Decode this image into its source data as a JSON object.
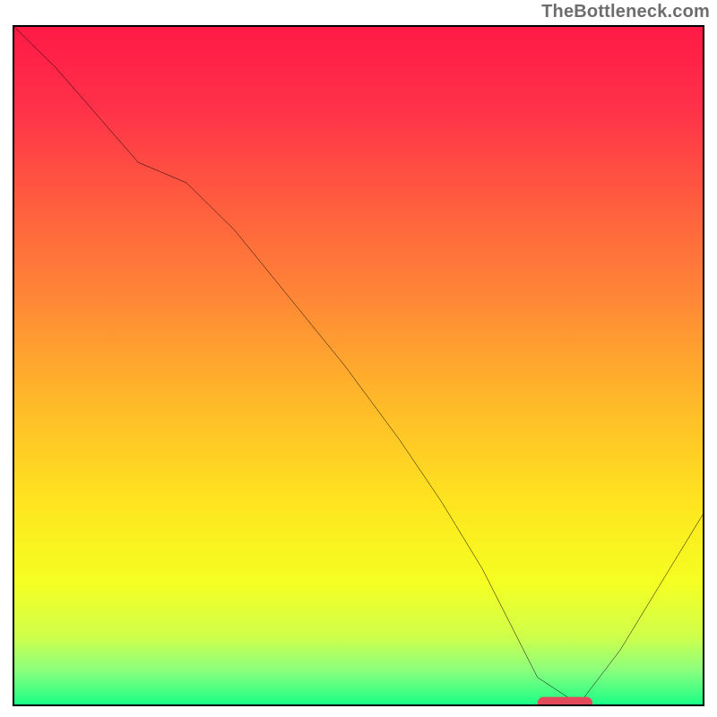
{
  "watermark": "TheBottleneck.com",
  "chart_data": {
    "type": "line",
    "title": "",
    "xlabel": "",
    "ylabel": "",
    "xlim": [
      0,
      100
    ],
    "ylim": [
      0,
      100
    ],
    "grid": false,
    "legend": false,
    "background_gradient": {
      "stops": [
        {
          "pos": 0.0,
          "color": "#ff1a45"
        },
        {
          "pos": 0.12,
          "color": "#ff3149"
        },
        {
          "pos": 0.25,
          "color": "#ff5a3f"
        },
        {
          "pos": 0.4,
          "color": "#ff8736"
        },
        {
          "pos": 0.55,
          "color": "#ffb82a"
        },
        {
          "pos": 0.7,
          "color": "#ffe41f"
        },
        {
          "pos": 0.82,
          "color": "#f5ff22"
        },
        {
          "pos": 0.9,
          "color": "#cfff4b"
        },
        {
          "pos": 0.95,
          "color": "#8bff7e"
        },
        {
          "pos": 1.0,
          "color": "#1aff86"
        }
      ]
    },
    "series": [
      {
        "name": "bottleneck-curve",
        "color": "#000000",
        "x": [
          0,
          6,
          12,
          18,
          25,
          32,
          40,
          48,
          56,
          62,
          68,
          72,
          76,
          82,
          88,
          94,
          100
        ],
        "y": [
          100,
          94,
          87,
          80,
          77,
          70,
          60,
          50,
          39,
          30,
          20,
          12,
          4,
          0,
          8,
          18,
          28
        ]
      }
    ],
    "marker": {
      "name": "minimum-marker",
      "shape": "rounded-rect",
      "color": "#e24a5b",
      "x_range": [
        76,
        84
      ],
      "y": 0
    }
  }
}
